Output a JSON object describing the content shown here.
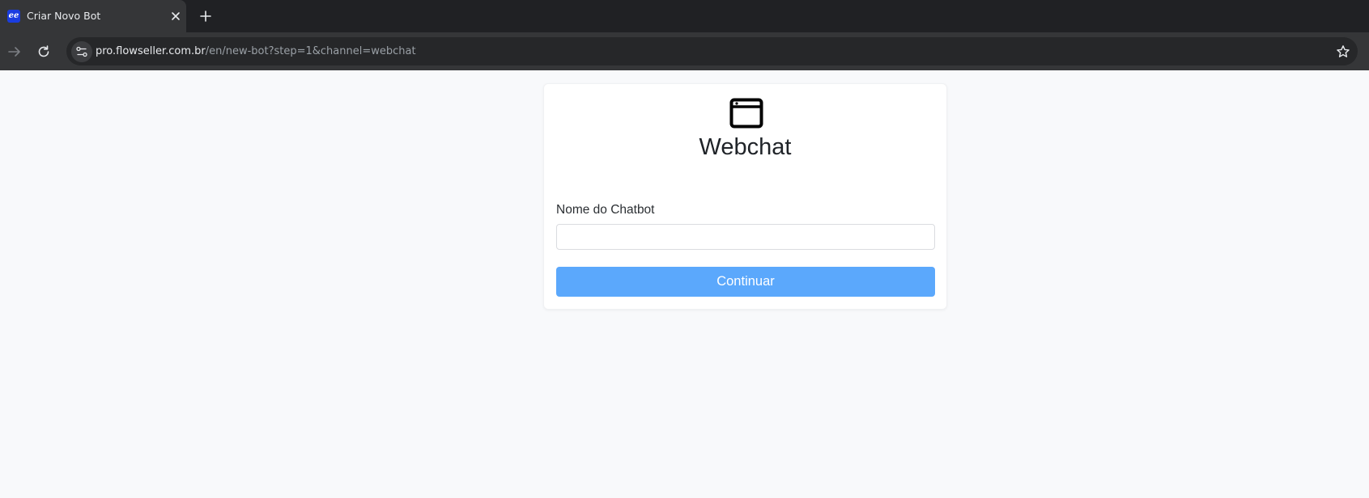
{
  "browser": {
    "tab": {
      "title": "Criar Novo Bot",
      "favicon_text": "ee"
    },
    "url": {
      "domain": "pro.flowseller.com.br",
      "path": "/en/new-bot?step=1&channel=webchat"
    }
  },
  "page": {
    "channel": {
      "icon": "browser-window-icon",
      "title": "Webchat"
    },
    "form": {
      "name_label": "Nome do Chatbot",
      "name_value": "",
      "name_placeholder": "",
      "continue_label": "Continuar"
    }
  },
  "colors": {
    "primary_button": "#5ba8fc",
    "page_background": "#f8f9fb",
    "chrome_dark": "#202124"
  }
}
